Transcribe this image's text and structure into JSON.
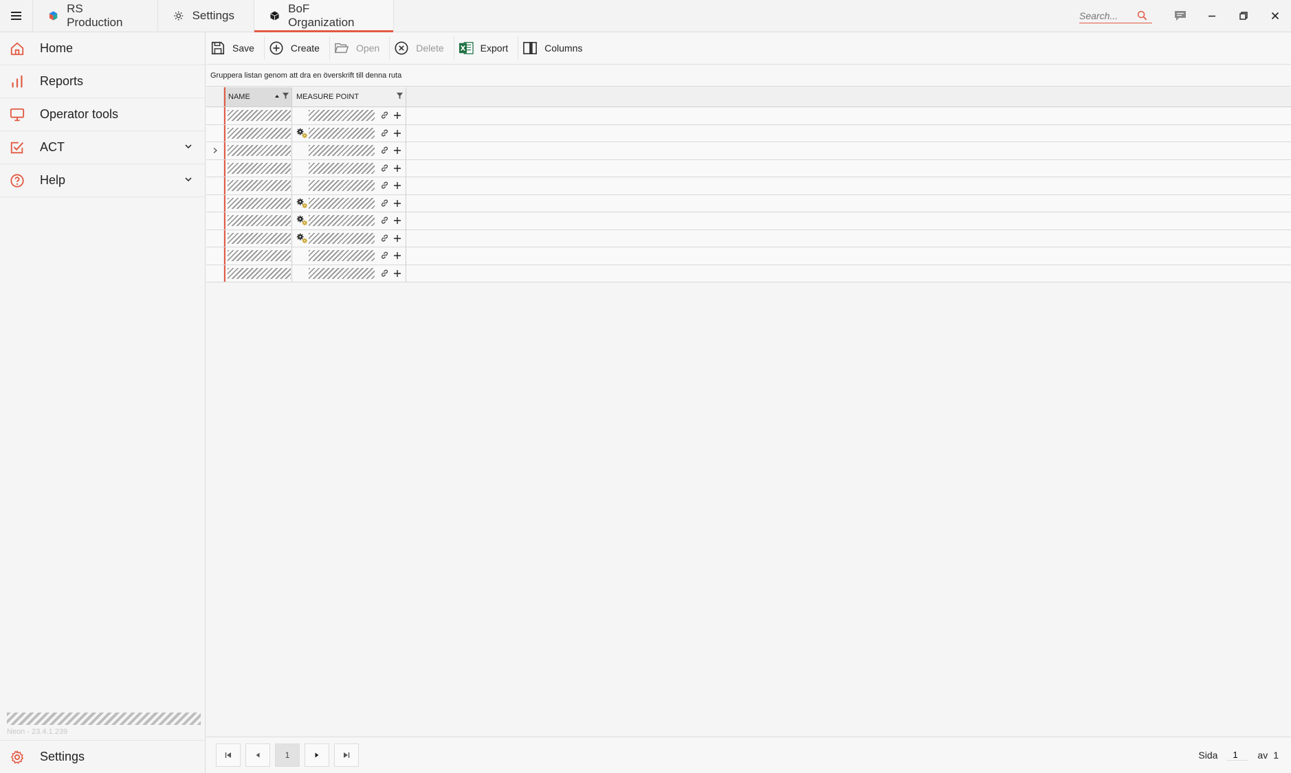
{
  "titlebar": {
    "tabs": [
      {
        "label": "RS Production",
        "icon": "rs-logo-icon"
      },
      {
        "label": "Settings",
        "icon": "gear-icon"
      },
      {
        "label": "BoF Organization",
        "icon": "box-icon",
        "active": true
      }
    ],
    "search_placeholder": "Search...",
    "accent": "#e25a43"
  },
  "sidebar": {
    "items": [
      {
        "label": "Home",
        "icon": "home-icon"
      },
      {
        "label": "Reports",
        "icon": "bar-chart-icon"
      },
      {
        "label": "Operator tools",
        "icon": "monitor-icon"
      },
      {
        "label": "ACT",
        "icon": "checkbox-icon",
        "expandable": true
      },
      {
        "label": "Help",
        "icon": "help-circle-icon",
        "expandable": true
      }
    ],
    "version": "Neon - 23.4.1.239",
    "settings_label": "Settings"
  },
  "toolbar": {
    "save": "Save",
    "create": "Create",
    "open": "Open",
    "delete": "Delete",
    "export": "Export",
    "columns": "Columns"
  },
  "group_panel": {
    "text": "Gruppera listan genom att dra en överskrift till denna ruta"
  },
  "grid": {
    "columns": [
      "NAME",
      "MEASURE POINT"
    ],
    "rows": [
      {
        "has_gear": false,
        "expandable": false
      },
      {
        "has_gear": true,
        "expandable": false
      },
      {
        "has_gear": false,
        "expandable": true
      },
      {
        "has_gear": false,
        "expandable": false
      },
      {
        "has_gear": false,
        "expandable": false
      },
      {
        "has_gear": true,
        "expandable": false
      },
      {
        "has_gear": true,
        "expandable": false
      },
      {
        "has_gear": true,
        "expandable": false
      },
      {
        "has_gear": false,
        "expandable": false
      },
      {
        "has_gear": false,
        "expandable": false
      }
    ]
  },
  "pager": {
    "current_page": "1",
    "page_label": "Sida",
    "page_value": "1",
    "of_label": "av",
    "total_pages": "1"
  }
}
